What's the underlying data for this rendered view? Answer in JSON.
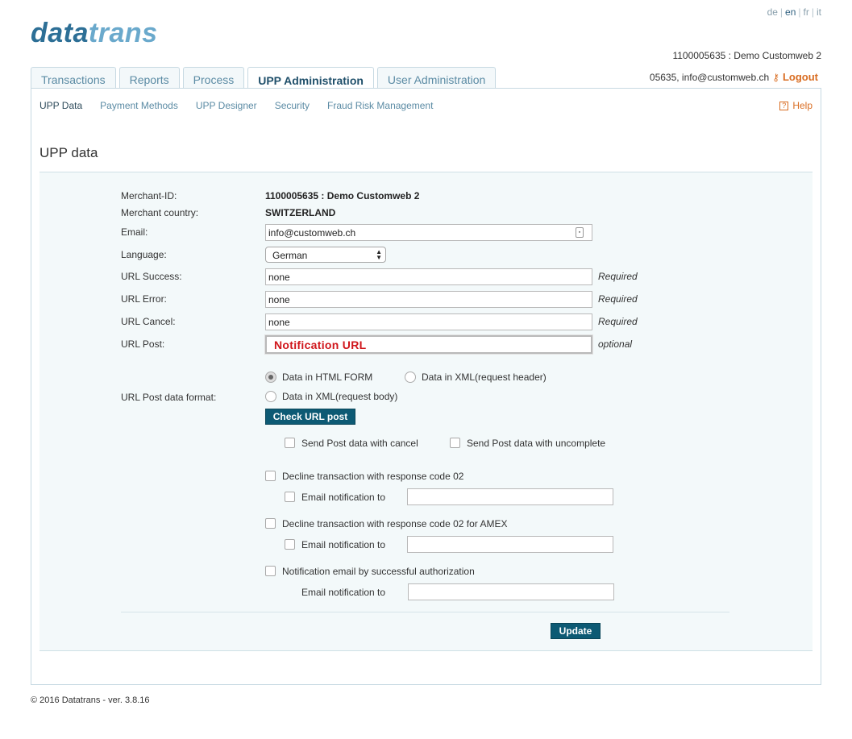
{
  "header": {
    "logo_part1": "data",
    "logo_part2": "trans",
    "languages": [
      "de",
      "en",
      "fr",
      "it"
    ],
    "active_language": "en",
    "merchant_info": "1100005635 : Demo Customweb 2",
    "user_info": "05635, info@customweb.ch",
    "logout_label": "Logout"
  },
  "tabs": [
    {
      "label": "Transactions"
    },
    {
      "label": "Reports"
    },
    {
      "label": "Process"
    },
    {
      "label": "UPP Administration",
      "active": true
    },
    {
      "label": "User Administration"
    }
  ],
  "subnav": [
    {
      "label": "UPP Data",
      "active": true
    },
    {
      "label": "Payment Methods"
    },
    {
      "label": "UPP Designer"
    },
    {
      "label": "Security"
    },
    {
      "label": "Fraud Risk Management"
    }
  ],
  "help_label": "Help",
  "page_title": "UPP data",
  "form": {
    "merchant_id_label": "Merchant-ID:",
    "merchant_id_value": "1100005635 : Demo Customweb 2",
    "merchant_country_label": "Merchant country:",
    "merchant_country_value": "SWITZERLAND",
    "email_label": "Email:",
    "email_value": "info@customweb.ch",
    "language_label": "Language:",
    "language_value": "German",
    "url_success_label": "URL Success:",
    "url_success_value": "none",
    "url_error_label": "URL Error:",
    "url_error_value": "none",
    "url_cancel_label": "URL Cancel:",
    "url_cancel_value": "none",
    "url_post_label": "URL Post:",
    "url_post_value": "Notification URL",
    "required_label": "Required",
    "optional_label": "optional",
    "post_format_label": "URL Post data format:",
    "format_html": "Data in HTML FORM",
    "format_xml_header": "Data in XML(request header)",
    "format_xml_body": "Data in XML(request body)",
    "check_url_button": "Check URL post",
    "send_cancel_label": "Send Post data with cancel",
    "send_uncomplete_label": "Send Post data with uncomplete",
    "decline_02_label": "Decline transaction with response code 02",
    "email_notification_label": "Email notification to",
    "decline_02_amex_label": "Decline transaction with response code 02 for AMEX",
    "notify_success_label": "Notification email by successful authorization",
    "update_button": "Update"
  },
  "footer": "© 2016 Datatrans - ver. 3.8.16"
}
